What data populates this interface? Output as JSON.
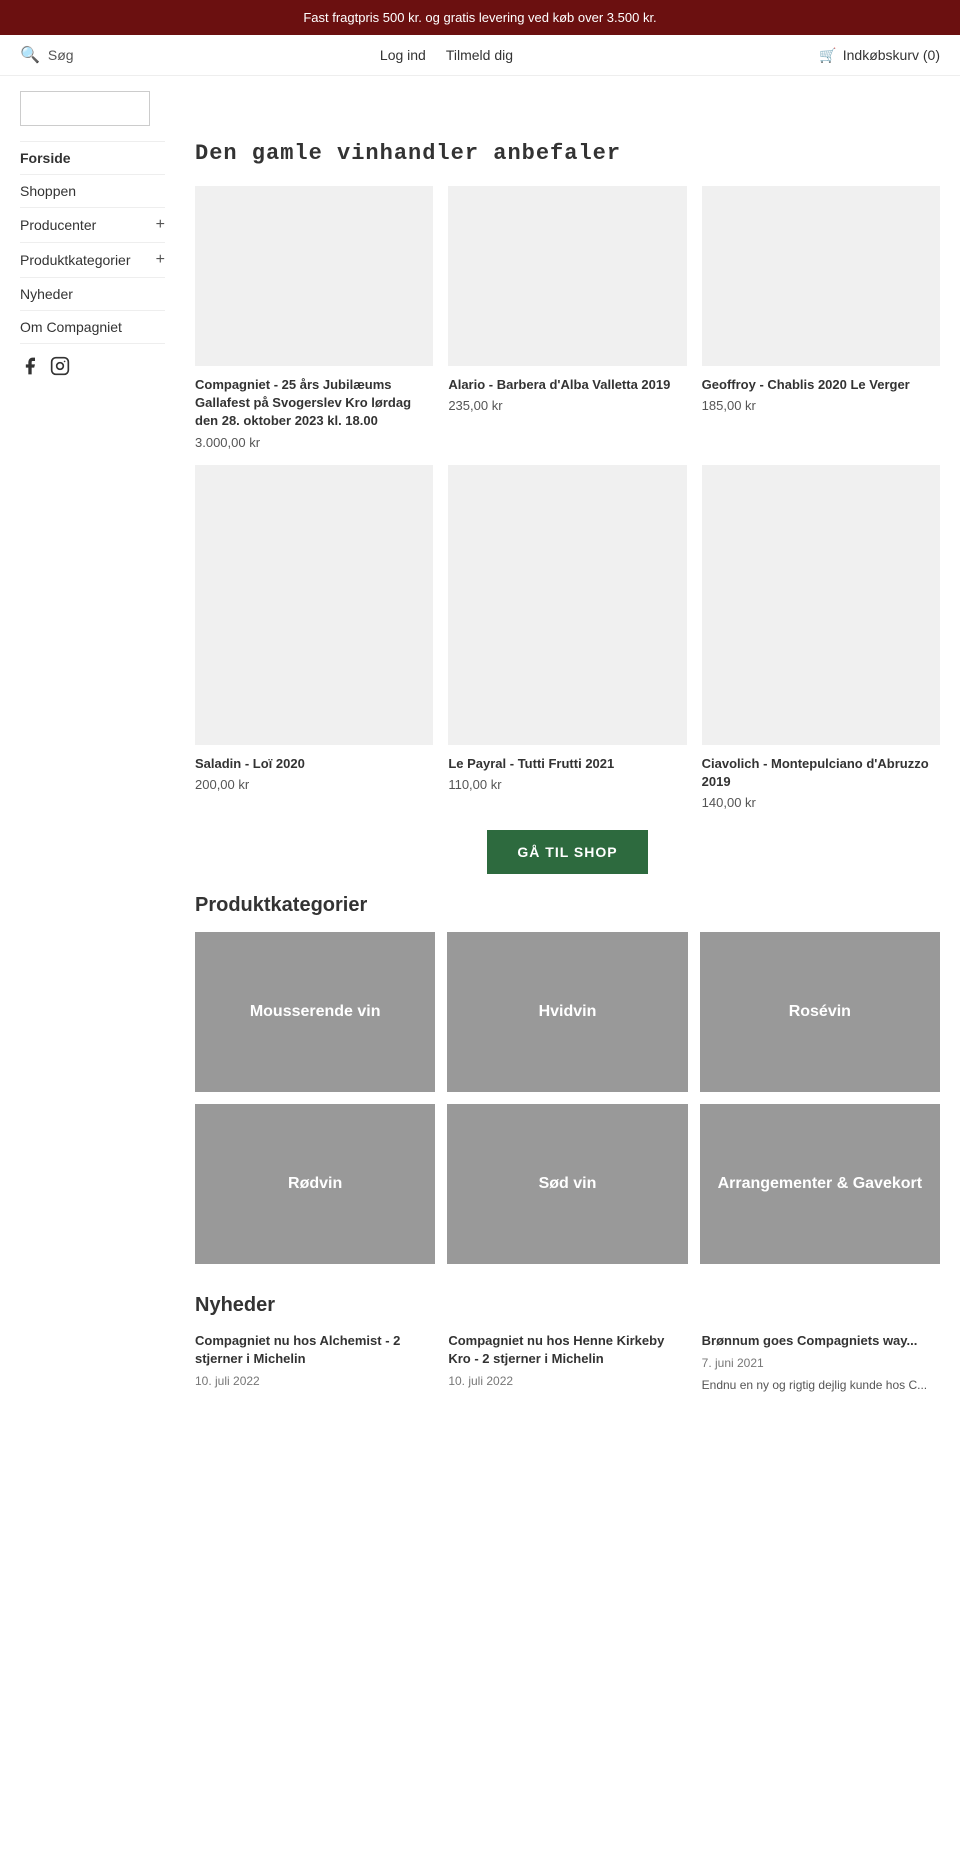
{
  "banner": {
    "text": "Fast fragtpris 500 kr. og gratis levering ved køb over 3.500 kr."
  },
  "header": {
    "search_label": "Søg",
    "login_label": "Log ind",
    "register_label": "Tilmeld dig",
    "cart_label": "Indkøbskurv (0)"
  },
  "sidebar": {
    "items": [
      {
        "label": "Forside",
        "active": true,
        "has_plus": false
      },
      {
        "label": "Shoppen",
        "active": false,
        "has_plus": false
      },
      {
        "label": "Producenter",
        "active": false,
        "has_plus": true
      },
      {
        "label": "Produktkategorier",
        "active": false,
        "has_plus": true
      },
      {
        "label": "Nyheder",
        "active": false,
        "has_plus": false
      },
      {
        "label": "Om Compagniet",
        "active": false,
        "has_plus": false
      }
    ],
    "social": [
      {
        "icon": "f",
        "name": "facebook"
      },
      {
        "icon": "ig",
        "name": "instagram"
      }
    ]
  },
  "recommendations": {
    "title": "Den gamle vinhandler anbefaler",
    "products": [
      {
        "name": "Compagniet - 25 års Jubilæums Gallafest på Svogerslev Kro lørdag den 28. oktober 2023 kl. 18.00",
        "price": "3.000,00 kr"
      },
      {
        "name": "Alario - Barbera d'Alba Valletta 2019",
        "price": "235,00 kr"
      },
      {
        "name": "Geoffroy - Chablis 2020 Le Verger",
        "price": "185,00 kr"
      },
      {
        "name": "Saladin - Loï 2020",
        "price": "200,00 kr"
      },
      {
        "name": "Le Payral - Tutti Frutti 2021",
        "price": "110,00 kr"
      },
      {
        "name": "Ciavolich - Montepulciano d'Abruzzo 2019",
        "price": "140,00 kr"
      }
    ]
  },
  "shop_button": {
    "label": "GÅ TIL SHOP"
  },
  "categories": {
    "title": "Produktkategorier",
    "items": [
      {
        "label": "Mousserende vin"
      },
      {
        "label": "Hvidvin"
      },
      {
        "label": "Rosévin"
      },
      {
        "label": "Rødvin"
      },
      {
        "label": "Sød vin"
      },
      {
        "label": "Arrangementer & Gavekort"
      }
    ]
  },
  "news": {
    "title": "Nyheder",
    "articles": [
      {
        "headline": "Compagniet nu hos Alchemist - 2 stjerner i Michelin",
        "date": "10. juli 2022",
        "excerpt": ""
      },
      {
        "headline": "Compagniet nu hos Henne Kirkeby Kro - 2 stjerner i Michelin",
        "date": "10. juli 2022",
        "excerpt": ""
      },
      {
        "headline": "Brønnum goes Compagniets way...",
        "date": "7. juni 2021",
        "excerpt": "Endnu en ny og rigtig dejlig kunde hos C..."
      }
    ]
  }
}
